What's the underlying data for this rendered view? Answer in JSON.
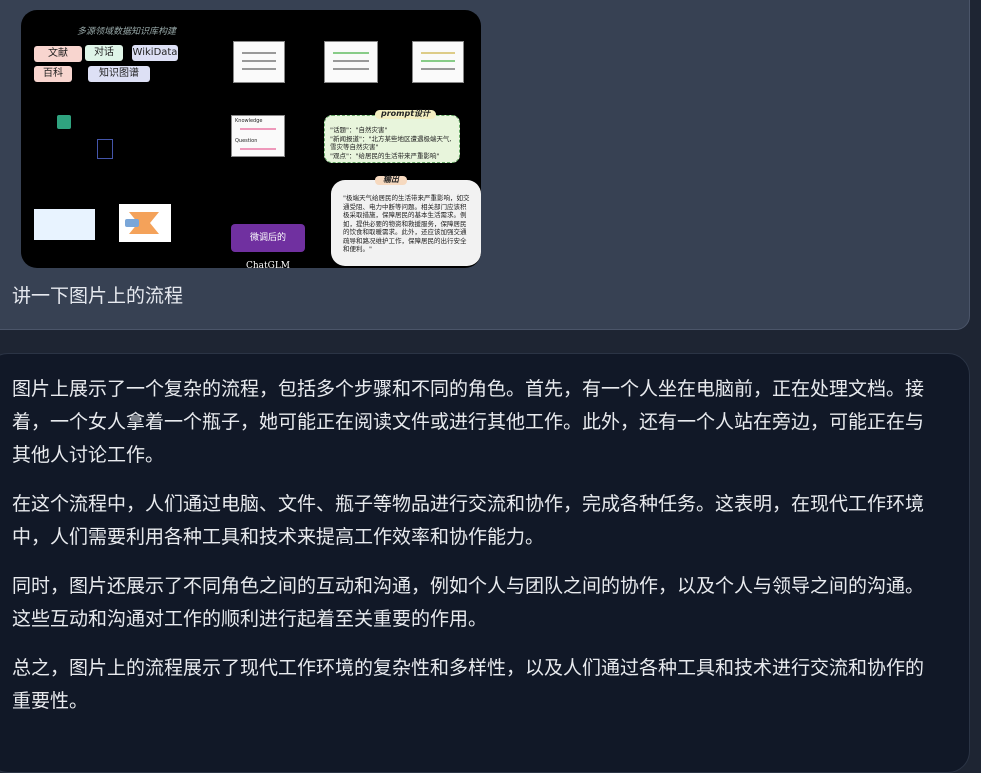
{
  "user_message": {
    "image": {
      "diagram_title": "多源领域数据知识库构建",
      "tags": [
        "文献",
        "对话",
        "WikiData",
        "百科",
        "知识图谱"
      ],
      "knowledge_label": "Knowledge",
      "question_label": "Question",
      "prompt": {
        "title": "prompt设计",
        "lines": [
          "\"话题\"：\"自然灾害\"",
          "\"新闻报道\"：\"北方某些地区遭遇极端天气,",
          "雪灾等自然灾害\"",
          "\"观点\"：\"给居民的生活带来严重影响\""
        ]
      },
      "output": {
        "title": "输出",
        "text": "\"极端天气给居民的生活带来严重影响，如交通受阻、电力中断等问题。相关部门应该积极采取措施，保障居民的基本生活需求。例如，提供必要的物资和救援服务，保障居民的饮食和取暖需求。此外，还应该加强交通疏导和路况维护工作，保障居民的出行安全和便利。\""
      },
      "model_label": "微调后的ChatGLM"
    },
    "text": "讲一下图片上的流程"
  },
  "assistant_message": {
    "paragraphs": [
      "图片上展示了一个复杂的流程，包括多个步骤和不同的角色。首先，有一个人坐在电脑前，正在处理文档。接着，一个女人拿着一个瓶子，她可能正在阅读文件或进行其他工作。此外，还有一个人站在旁边，可能正在与其他人讨论工作。",
      "在这个流程中，人们通过电脑、文件、瓶子等物品进行交流和协作，完成各种任务。这表明，在现代工作环境中，人们需要利用各种工具和技术来提高工作效率和协作能力。",
      "同时，图片还展示了不同角色之间的互动和沟通，例如个人与团队之间的协作，以及个人与领导之间的沟通。这些互动和沟通对工作的顺利进行起着至关重要的作用。",
      "总之，图片上的流程展示了现代工作环境的复杂性和多样性，以及人们通过各种工具和技术进行交流和协作的重要性。"
    ]
  },
  "colors": {
    "user_bg": "#374153",
    "assistant_bg": "#111827",
    "page_bg": "#1e2533",
    "text": "#e8eaee"
  }
}
